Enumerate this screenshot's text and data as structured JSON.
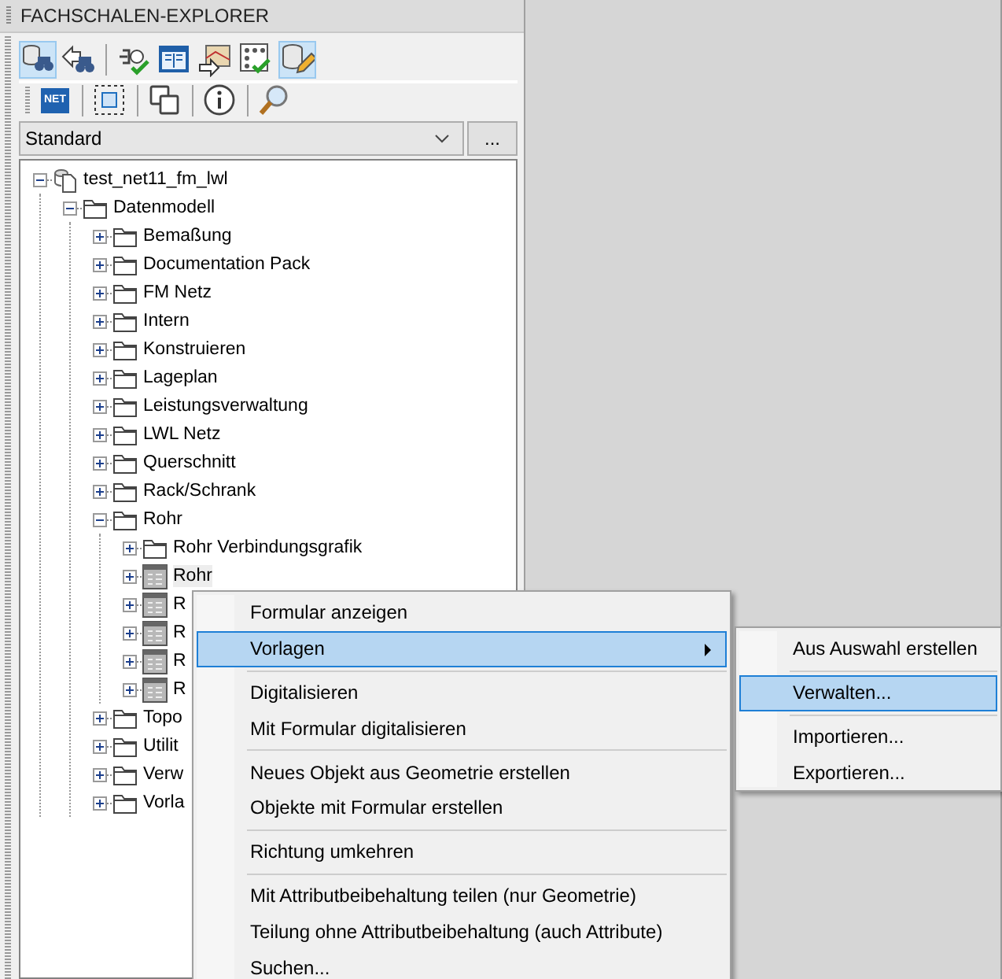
{
  "panel": {
    "title": "FACHSCHALEN-EXPLORER"
  },
  "toolbar_1": [
    {
      "kind": "db-binoculars",
      "pressed": true
    },
    {
      "kind": "arrow-binoculars",
      "pressed": false
    },
    {
      "kind": "separator"
    },
    {
      "kind": "plug-check",
      "pressed": false
    },
    {
      "kind": "book",
      "pressed": false
    },
    {
      "kind": "map-export",
      "pressed": false
    },
    {
      "kind": "grid-check",
      "pressed": false
    },
    {
      "kind": "db-pencil",
      "pressed": true
    }
  ],
  "toolbar_2": [
    {
      "kind": "net-logo",
      "label": "NET"
    },
    {
      "kind": "separator"
    },
    {
      "kind": "dashed-select"
    },
    {
      "kind": "separator"
    },
    {
      "kind": "copy"
    },
    {
      "kind": "separator"
    },
    {
      "kind": "info"
    },
    {
      "kind": "separator"
    },
    {
      "kind": "search"
    }
  ],
  "profile_select": {
    "value": "Standard",
    "button": "..."
  },
  "tree": [
    {
      "label": "test_net11_fm_lwl",
      "kind": "database",
      "expanded": true,
      "selected": false,
      "children": [
        {
          "label": "Datenmodell",
          "kind": "folder",
          "expanded": true,
          "selected": false,
          "children": [
            {
              "label": "Bemaßung",
              "kind": "folder",
              "expanded": false,
              "selected": false
            },
            {
              "label": "Documentation Pack",
              "kind": "folder",
              "expanded": false,
              "selected": false
            },
            {
              "label": "FM Netz",
              "kind": "folder",
              "expanded": false,
              "selected": false
            },
            {
              "label": "Intern",
              "kind": "folder",
              "expanded": false,
              "selected": false
            },
            {
              "label": "Konstruieren",
              "kind": "folder",
              "expanded": false,
              "selected": false
            },
            {
              "label": "Lageplan",
              "kind": "folder",
              "expanded": false,
              "selected": false
            },
            {
              "label": "Leistungsverwaltung",
              "kind": "folder",
              "expanded": false,
              "selected": false
            },
            {
              "label": "LWL Netz",
              "kind": "folder",
              "expanded": false,
              "selected": false
            },
            {
              "label": "Querschnitt",
              "kind": "folder",
              "expanded": false,
              "selected": false
            },
            {
              "label": "Rack/Schrank",
              "kind": "folder",
              "expanded": false,
              "selected": false
            },
            {
              "label": "Rohr",
              "kind": "folder",
              "expanded": true,
              "selected": false,
              "children": [
                {
                  "label": "Rohr Verbindungsgrafik",
                  "kind": "folder",
                  "expanded": false,
                  "selected": false
                },
                {
                  "label": "Rohr",
                  "kind": "table",
                  "expanded": false,
                  "selected": true
                },
                {
                  "label": "R",
                  "kind": "table",
                  "expanded": false,
                  "selected": false
                },
                {
                  "label": "R",
                  "kind": "table",
                  "expanded": false,
                  "selected": false
                },
                {
                  "label": "R",
                  "kind": "table",
                  "expanded": false,
                  "selected": false
                },
                {
                  "label": "R",
                  "kind": "table",
                  "expanded": false,
                  "selected": false
                }
              ]
            },
            {
              "label": "Topo",
              "kind": "folder",
              "expanded": false,
              "selected": false
            },
            {
              "label": "Utilit",
              "kind": "folder",
              "expanded": false,
              "selected": false
            },
            {
              "label": "Verw",
              "kind": "folder",
              "expanded": false,
              "selected": false
            },
            {
              "label": "Vorla",
              "kind": "folder",
              "expanded": false,
              "selected": false
            }
          ]
        }
      ]
    }
  ],
  "context_menu": {
    "groups": [
      [
        {
          "label": "Formular anzeigen",
          "selected": false,
          "submenu": false
        },
        {
          "label": "Vorlagen",
          "selected": true,
          "submenu": true
        }
      ],
      [
        {
          "label": "Digitalisieren",
          "selected": false,
          "submenu": false
        },
        {
          "label": "Mit Formular digitalisieren",
          "selected": false,
          "submenu": false
        }
      ],
      [
        {
          "label": "Neues Objekt aus Geometrie erstellen",
          "selected": false,
          "submenu": false
        },
        {
          "label": "Objekte mit Formular erstellen",
          "selected": false,
          "submenu": false
        }
      ],
      [
        {
          "label": "Richtung umkehren",
          "selected": false,
          "submenu": false
        }
      ],
      [
        {
          "label": "Mit Attributbeibehaltung teilen (nur Geometrie)",
          "selected": false,
          "submenu": false
        },
        {
          "label": "Teilung ohne Attributbeibehaltung (auch Attribute)",
          "selected": false,
          "submenu": false
        },
        {
          "label": "Suchen...",
          "selected": false,
          "submenu": false
        }
      ]
    ]
  },
  "submenu": {
    "groups": [
      [
        {
          "label": "Aus Auswahl erstellen",
          "selected": false
        }
      ],
      [
        {
          "label": "Verwalten...",
          "selected": true
        }
      ],
      [
        {
          "label": "Importieren...",
          "selected": false
        },
        {
          "label": "Exportieren...",
          "selected": false
        }
      ]
    ]
  }
}
